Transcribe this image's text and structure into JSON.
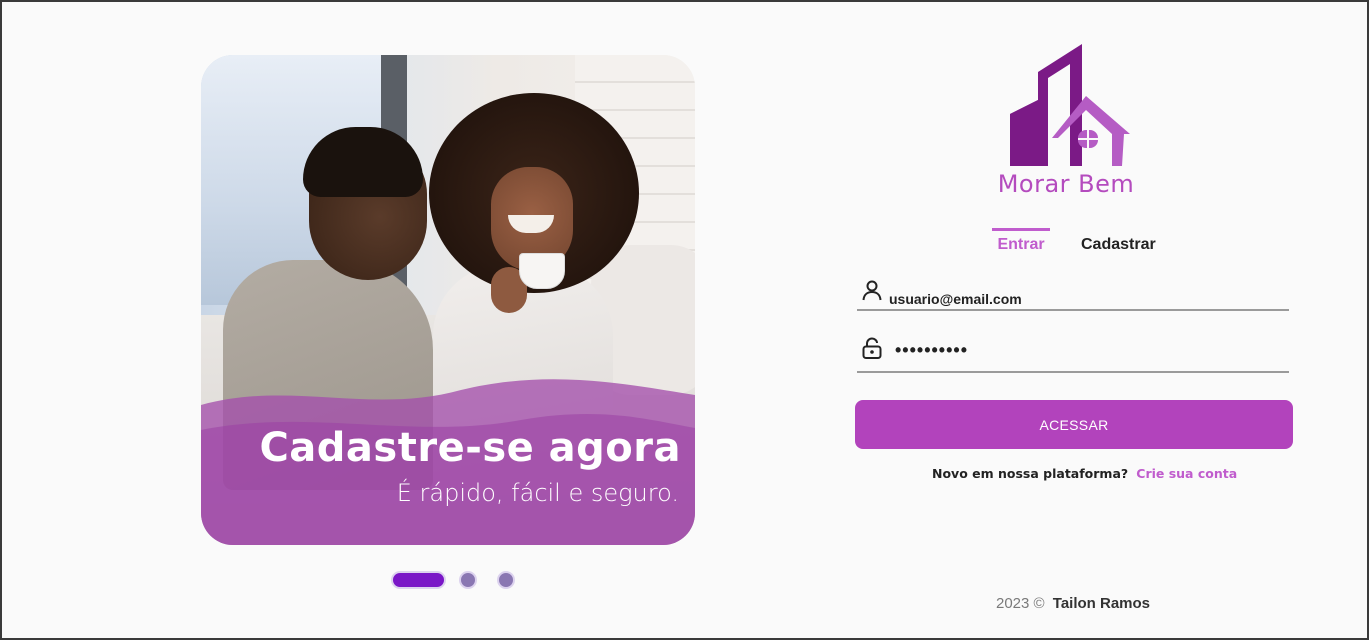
{
  "hero": {
    "title": "Cadastre-se agora",
    "subtitle": "É rápido, fácil e seguro.",
    "image_icon": "couple-photo",
    "carousel": {
      "slides": 3,
      "active_index": 0
    }
  },
  "brand": {
    "name": "Morar Bem",
    "logo_icon": "building-house-logo",
    "colors": {
      "primary": "#b243bc",
      "dark": "#7b1a86",
      "accent": "#7a16c7"
    }
  },
  "tabs": [
    {
      "label": "Entrar",
      "active": true
    },
    {
      "label": "Cadastrar",
      "active": false
    }
  ],
  "form": {
    "email": {
      "value": "usuario@email.com",
      "icon": "user-icon"
    },
    "password": {
      "value": "••••••••••",
      "icon": "unlock-icon"
    },
    "submit_label": "ACESSAR"
  },
  "signup": {
    "question": "Novo em nossa plataforma?",
    "link": "Crie sua conta"
  },
  "footer": {
    "year": "2023 ©",
    "author": "Tailon Ramos"
  }
}
